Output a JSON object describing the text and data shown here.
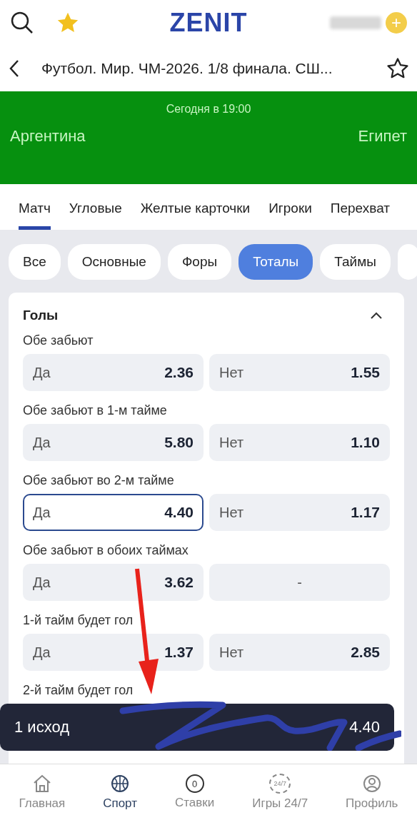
{
  "header": {
    "logo": "ZENIT",
    "add_symbol": "+"
  },
  "event_bar": {
    "title": "Футбол. Мир. ЧМ-2026. 1/8 финала. СШ..."
  },
  "match": {
    "time": "Сегодня в 19:00",
    "home": "Аргентина",
    "away": "Египет"
  },
  "tabs": [
    {
      "label": "Матч",
      "selected": true
    },
    {
      "label": "Угловые",
      "selected": false
    },
    {
      "label": "Желтые карточки",
      "selected": false
    },
    {
      "label": "Игроки",
      "selected": false
    },
    {
      "label": "Перехват",
      "selected": false
    }
  ],
  "filters": [
    {
      "label": "Все",
      "selected": false
    },
    {
      "label": "Основные",
      "selected": false
    },
    {
      "label": "Форы",
      "selected": false
    },
    {
      "label": "Тоталы",
      "selected": true
    },
    {
      "label": "Таймы",
      "selected": false
    }
  ],
  "section": {
    "title": "Голы",
    "expanded": true,
    "markets": [
      {
        "title": "Обе забьют",
        "outcomes": [
          {
            "label": "Да",
            "odds": "2.36",
            "selected": false
          },
          {
            "label": "Нет",
            "odds": "1.55",
            "selected": false
          }
        ]
      },
      {
        "title": "Обе забьют в 1-м тайме",
        "outcomes": [
          {
            "label": "Да",
            "odds": "5.80",
            "selected": false
          },
          {
            "label": "Нет",
            "odds": "1.10",
            "selected": false
          }
        ]
      },
      {
        "title": "Обе забьют во 2-м тайме",
        "outcomes": [
          {
            "label": "Да",
            "odds": "4.40",
            "selected": true
          },
          {
            "label": "Нет",
            "odds": "1.17",
            "selected": false
          }
        ]
      },
      {
        "title": "Обе забьют в обоих таймах",
        "outcomes": [
          {
            "label": "Да",
            "odds": "3.62",
            "selected": false
          },
          {
            "label": "-",
            "selected": false
          }
        ]
      },
      {
        "title": "1-й тайм будет гол",
        "outcomes": [
          {
            "label": "Да",
            "odds": "1.37",
            "selected": false
          },
          {
            "label": "Нет",
            "odds": "2.85",
            "selected": false
          }
        ]
      },
      {
        "title": "2-й тайм будет гол"
      }
    ]
  },
  "bet_slip": {
    "label": "1 исход",
    "total": "4.40"
  },
  "bottom_nav": [
    {
      "label": "Главная",
      "kind": "home",
      "selected": false
    },
    {
      "label": "Спорт",
      "kind": "sport",
      "selected": true
    },
    {
      "label": "Ставки",
      "kind": "bets",
      "badge": "0",
      "selected": false
    },
    {
      "label": "Игры 24/7",
      "kind": "games",
      "badge": "24/7",
      "selected": false
    },
    {
      "label": "Профиль",
      "kind": "profile",
      "selected": false
    }
  ]
}
